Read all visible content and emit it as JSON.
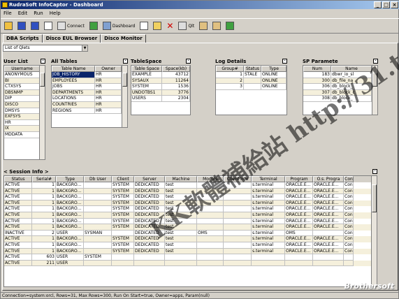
{
  "window": {
    "title": "RudraSoft InfoCaptor - Dashboard"
  },
  "menu": [
    "File",
    "Edit",
    "Run",
    "Help"
  ],
  "toolbar": {
    "connect": "Connect",
    "dashboard": "Dashboard",
    "quit": "Qlt"
  },
  "tabs": [
    "DBA Scripts",
    "Disco EUL Browser",
    "Disco Monitor"
  ],
  "combo": "List of Qlets",
  "user_list": {
    "title": "User List",
    "header": "Username",
    "rows": [
      "ANONYMOUS",
      "BI",
      "CTXSYS",
      "DBSNMP",
      "DIP",
      "DISCO",
      "DMSYS",
      "EXFSYS",
      "HR",
      "IX",
      "MDDATA"
    ]
  },
  "all_tables": {
    "title": "All Tables",
    "headers": [
      "Table Name",
      "Owner"
    ],
    "rows": [
      [
        "JOB_HISTORY",
        "HR"
      ],
      [
        "EMPLOYEES",
        "HR"
      ],
      [
        "JOBS",
        "HR"
      ],
      [
        "DEPARTMENTS",
        "HR"
      ],
      [
        "LOCATIONS",
        "HR"
      ],
      [
        "COUNTRIES",
        "HR"
      ],
      [
        "REGIONS",
        "HR"
      ]
    ]
  },
  "tablespace": {
    "title": "TableSpace",
    "headers": [
      "Table Space",
      "Space(kb)"
    ],
    "rows": [
      [
        "EXAMPLE",
        "43712"
      ],
      [
        "SYSAUX",
        "11264"
      ],
      [
        "SYSTEM",
        "1536"
      ],
      [
        "UNDOTBS1",
        "3776"
      ],
      [
        "USERS",
        "2304"
      ]
    ]
  },
  "log_details": {
    "title": "Log Details",
    "headers": [
      "Group#",
      "Status",
      "Type"
    ],
    "rows": [
      [
        "1",
        "STALE",
        "ONLINE"
      ],
      [
        "2",
        "",
        "ONLINE"
      ],
      [
        "3",
        "",
        "ONLINE"
      ]
    ]
  },
  "sp_params": {
    "title": "SP Paramete",
    "headers": [
      "Num",
      "Name"
    ],
    "rows": [
      [
        "183",
        "dbwr_io_sl"
      ],
      [
        "300",
        "db_file_na"
      ],
      [
        "306",
        "db_block_"
      ],
      [
        "307",
        "db_block_c"
      ],
      [
        "308",
        "db_block_"
      ]
    ]
  },
  "session_info": {
    "title": "< Session Info >",
    "headers": [
      "Status",
      "Serial#",
      "Type",
      "Db User",
      "Client",
      "Server",
      "Machine",
      "Module",
      "Client Info",
      "Terminal",
      "Program",
      "O.s. Progra",
      "Con"
    ],
    "rows": [
      [
        "ACTIVE",
        "1",
        "BACKGRO...",
        "",
        "SYSTEM",
        "DEDICATED",
        "test",
        "",
        "",
        "s.terminal",
        "ORACLE.E...",
        "ORACLE.E...",
        "Con"
      ],
      [
        "ACTIVE",
        "1",
        "BACKGRO...",
        "",
        "SYSTEM",
        "DEDICATED",
        "test",
        "",
        "",
        "s.terminal",
        "ORACLE.E...",
        "ORACLE.E...",
        "Con"
      ],
      [
        "ACTIVE",
        "1",
        "BACKGRO...",
        "",
        "SYSTEM",
        "DEDICATED",
        "test",
        "",
        "",
        "s.terminal",
        "ORACLE.E...",
        "ORACLE.E...",
        "Con"
      ],
      [
        "ACTIVE",
        "1",
        "BACKGRO...",
        "",
        "SYSTEM",
        "DEDICATED",
        "test",
        "",
        "",
        "s.terminal",
        "ORACLE.E...",
        "ORACLE.E...",
        "Con"
      ],
      [
        "ACTIVE",
        "1",
        "BACKGRO...",
        "",
        "SYSTEM",
        "DEDICATED",
        "test",
        "",
        "",
        "s.terminal",
        "ORACLE.E...",
        "ORACLE.E...",
        "Con"
      ],
      [
        "ACTIVE",
        "1",
        "BACKGRO...",
        "",
        "SYSTEM",
        "DEDICATED",
        "test",
        "",
        "",
        "s.terminal",
        "ORACLE.E...",
        "ORACLE.E...",
        "Con"
      ],
      [
        "ACTIVE",
        "1",
        "BACKGRO...",
        "",
        "SYSTEM",
        "DEDICATED",
        "test",
        "",
        "",
        "s.terminal",
        "ORACLE.E...",
        "ORACLE.E...",
        "Con"
      ],
      [
        "ACTIVE",
        "1",
        "BACKGRO...",
        "",
        "SYSTEM",
        "DEDICATED",
        "test",
        "",
        "",
        "s.terminal",
        "ORACLE.E...",
        "ORACLE.E...",
        "Con"
      ],
      [
        "INACTIVE",
        "2",
        "USER",
        "SYSMAN",
        "",
        "DEDICATED",
        "test",
        "OMS",
        "",
        "s.terminal",
        "OMS",
        "",
        "Con"
      ],
      [
        "ACTIVE",
        "1",
        "BACKGRO...",
        "",
        "SYSTEM",
        "DEDICATED",
        "test",
        "",
        "",
        "s.terminal",
        "ORACLE.E...",
        "ORACLE.E...",
        "Con"
      ],
      [
        "ACTIVE",
        "1",
        "BACKGRO...",
        "",
        "SYSTEM",
        "DEDICATED",
        "test",
        "",
        "",
        "s.terminal",
        "ORACLE.E...",
        "ORACLE.E...",
        "Con"
      ],
      [
        "ACTIVE",
        "1",
        "BACKGRO...",
        "",
        "SYSTEM",
        "DEDICATED",
        "test",
        "",
        "",
        "s.terminal",
        "ORACLE.E...",
        "ORACLE.E...",
        "Con"
      ],
      [
        "ACTIVE",
        "603",
        "USER",
        "SYSTEM",
        "",
        "",
        "",
        "",
        "",
        "",
        "",
        "",
        ""
      ],
      [
        "ACTIVE",
        "211",
        "USER",
        "",
        "",
        "",
        "",
        "",
        "",
        "",
        "",
        "",
        ""
      ]
    ]
  },
  "status_text": "Connection=system:orcl, Rows=31, Max Rows=300, Run On Start=true, Owner=apps, Param(null)",
  "watermark": "KK軟體補給站 http://31.to",
  "brand": "Brothersoft"
}
